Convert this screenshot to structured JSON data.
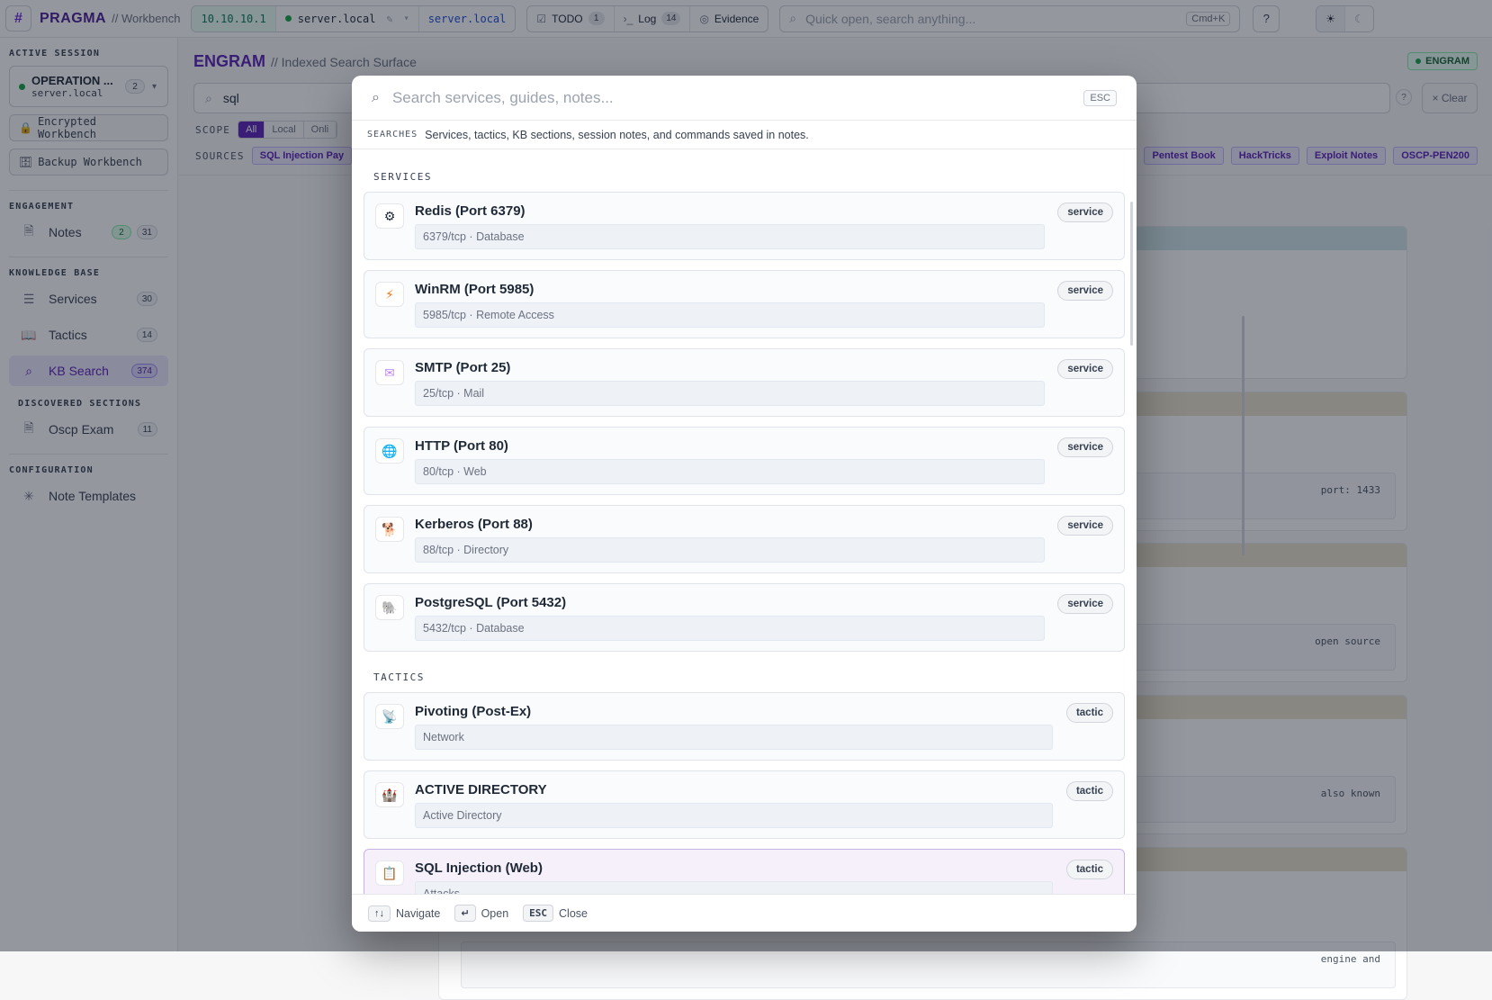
{
  "topbar": {
    "logo": "#",
    "brand": "PRAGMA",
    "brand_sub": "// Workbench",
    "ip": "10.10.10.1",
    "host": "server.local",
    "host_link": "server.local",
    "todo_label": "TODO",
    "todo_count": "1",
    "log_label": "Log",
    "log_count": "14",
    "evidence_label": "Evidence",
    "search_placeholder": "Quick open, search anything...",
    "search_shortcut": "Cmd+K",
    "help": "?"
  },
  "sidebar": {
    "active_session_title": "ACTIVE SESSION",
    "session_name": "OPERATION ...",
    "session_host": "server.local",
    "session_count": "2",
    "encrypted_btn": "Encrypted Workbench",
    "backup_btn": "Backup Workbench",
    "engagement_title": "ENGAGEMENT",
    "notes_label": "Notes",
    "notes_badge_a": "2",
    "notes_badge_b": "31",
    "kb_title": "KNOWLEDGE BASE",
    "services_label": "Services",
    "services_count": "30",
    "tactics_label": "Tactics",
    "tactics_count": "14",
    "kbsearch_label": "KB Search",
    "kbsearch_count": "374",
    "discovered_title": "DISCOVERED SECTIONS",
    "oscp_label": "Oscp Exam",
    "oscp_count": "11",
    "config_title": "CONFIGURATION",
    "templates_label": "Note Templates"
  },
  "main": {
    "title": "ENGRAM",
    "subtitle": "// Indexed Search Surface",
    "badge": "ENGRAM",
    "query": "sql",
    "clear": "× Clear",
    "scope_label": "SCOPE",
    "scope_chips": [
      "All",
      "Local",
      "Onli"
    ],
    "sources_label": "SOURCES",
    "sources_left": "SQL Injection Pay",
    "sources_right": [
      "Pentest Book",
      "HackTricks",
      "Exploit Notes",
      "OSCP-PEN200"
    ],
    "snippets": [
      "port: 1433",
      "open source",
      "also known",
      "engine and"
    ]
  },
  "palette": {
    "search_placeholder": "Search services, guides, notes...",
    "esc": "ESC",
    "hint_key": "SEARCHES",
    "hint_text": "Services, tactics, KB sections, session notes, and commands saved in notes.",
    "services_title": "SERVICES",
    "tactics_title": "TACTICS",
    "services": [
      {
        "title": "Redis (Port 6379)",
        "sub": "6379/tcp · Database",
        "tag": "service",
        "icon": "⚙"
      },
      {
        "title": "WinRM (Port 5985)",
        "sub": "5985/tcp · Remote Access",
        "tag": "service",
        "icon": "⚡"
      },
      {
        "title": "SMTP (Port 25)",
        "sub": "25/tcp · Mail",
        "tag": "service",
        "icon": "✉"
      },
      {
        "title": "HTTP (Port 80)",
        "sub": "80/tcp · Web",
        "tag": "service",
        "icon": "🌐"
      },
      {
        "title": "Kerberos (Port 88)",
        "sub": "88/tcp · Directory",
        "tag": "service",
        "icon": "🐕"
      },
      {
        "title": "PostgreSQL (Port 5432)",
        "sub": "5432/tcp · Database",
        "tag": "service",
        "icon": "🐘"
      }
    ],
    "tactics": [
      {
        "title": "Pivoting (Post-Ex)",
        "sub": "Network",
        "tag": "tactic",
        "icon": "📡"
      },
      {
        "title": "ACTIVE DIRECTORY",
        "sub": "Active Directory",
        "tag": "tactic",
        "icon": "🏰"
      },
      {
        "title": "SQL Injection (Web)",
        "sub": "Attacks",
        "tag": "tactic",
        "icon": "📋"
      }
    ],
    "footer": {
      "nav_key": "↑↓",
      "nav_label": "Navigate",
      "open_key": "↵",
      "open_label": "Open",
      "close_key": "ESC",
      "close_label": "Close"
    }
  }
}
